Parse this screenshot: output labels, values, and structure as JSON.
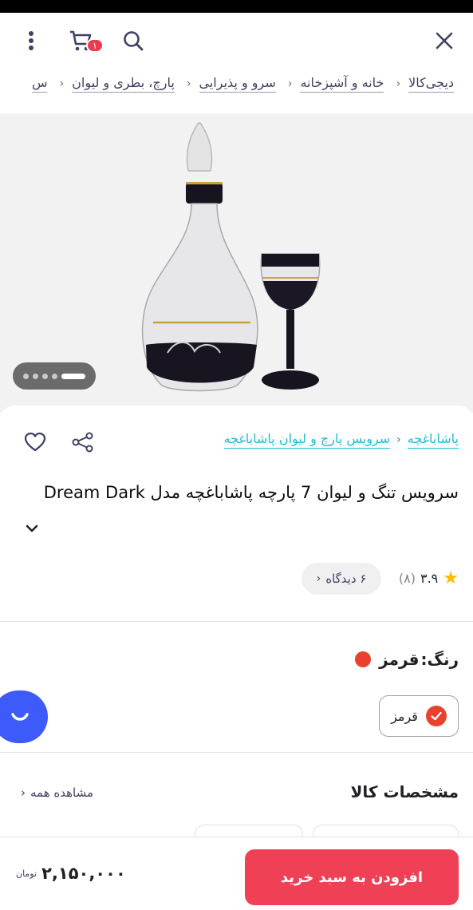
{
  "topbar": {
    "close_icon": "close-icon",
    "cart_count": "۱",
    "icons": [
      "more-icon",
      "cart-icon",
      "search-icon",
      "close-icon"
    ]
  },
  "breadcrumbs": [
    "دیجی‌کالا",
    "خانه و آشپزخانه",
    "سرو و پذیرایی",
    "پارچ، بطری و لیوان",
    "س"
  ],
  "product": {
    "brand": "پاشاباغچه",
    "category": "سرویس پارچ و لیوان پاشاباغچه",
    "title": "سرویس تنگ و لیوان 7 پارچه پاشاباغچه مدل Dream Dark",
    "rating": "۳.۹",
    "rating_count": "(۸)",
    "reviews_label": "۶ دیدگاه",
    "color_label": "رنگ:",
    "color_value": "قرمز",
    "color_option": "قرمز",
    "color_hex": "#e8412e",
    "gallery_images": 5,
    "gallery_active": 5
  },
  "specs": {
    "title": "مشخصات کالا",
    "view_all": "مشاهده همه"
  },
  "buy": {
    "add_to_cart": "افزودن به سبد خرید",
    "price": "۲,۱۵۰,۰۰۰",
    "currency": "تومان"
  },
  "colors": {
    "accent": "#ef4056",
    "link": "#19bfd3",
    "fab": "#3c5bfa"
  }
}
